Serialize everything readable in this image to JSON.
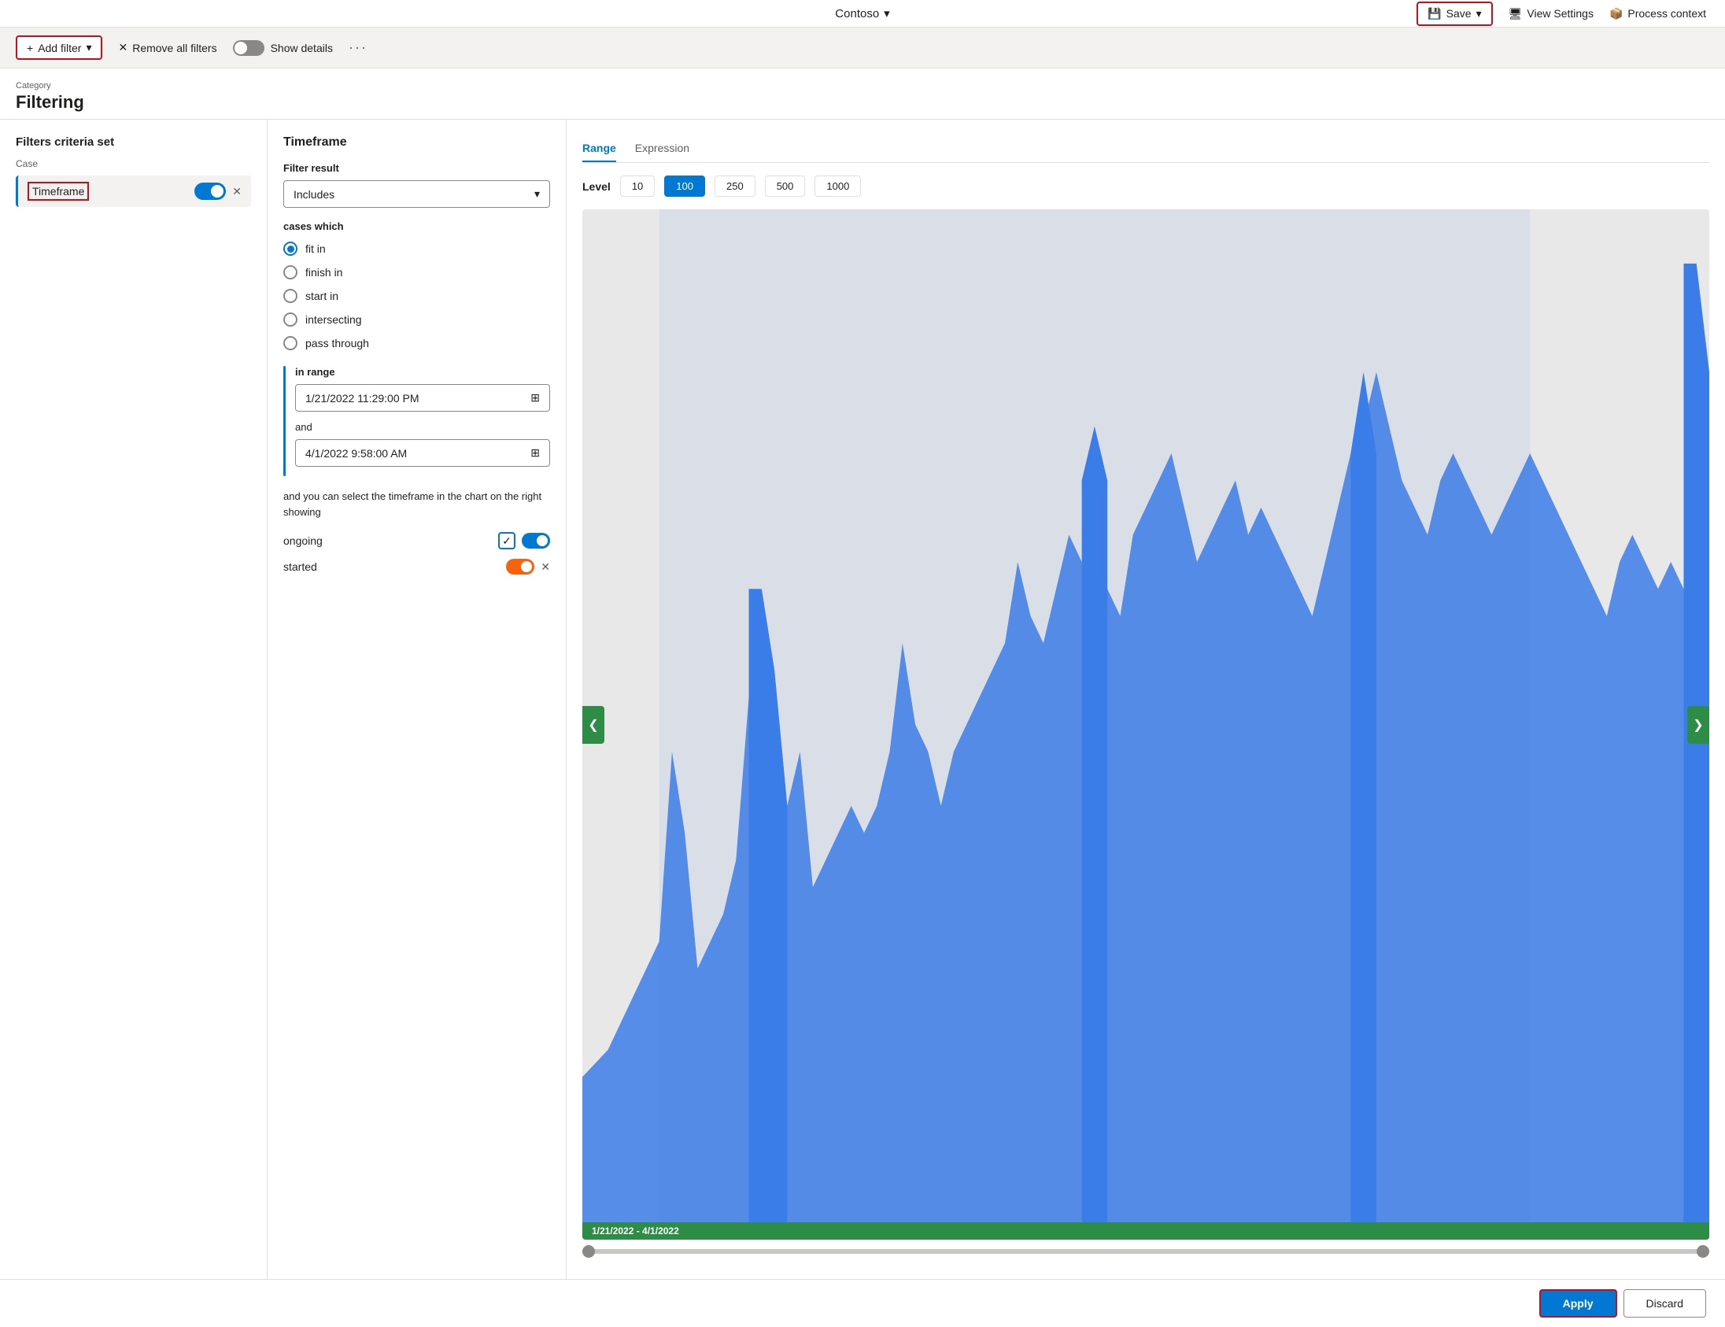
{
  "topnav": {
    "title": "Contoso",
    "save_label": "Save",
    "view_settings_label": "View Settings",
    "process_context_label": "Process context"
  },
  "toolbar": {
    "add_filter_label": "Add filter",
    "remove_all_label": "Remove all filters",
    "show_details_label": "Show details",
    "more_icon": "···"
  },
  "category": {
    "label": "Category",
    "title": "Filtering"
  },
  "left_panel": {
    "title": "Filters criteria set",
    "case_label": "Case",
    "filter_name": "Timeframe"
  },
  "mid_panel": {
    "title": "Timeframe",
    "filter_result_label": "Filter result",
    "filter_result_value": "Includes",
    "cases_which_label": "cases which",
    "radio_options": [
      {
        "id": "fit_in",
        "label": "fit in",
        "selected": true
      },
      {
        "id": "finish_in",
        "label": "finish in",
        "selected": false
      },
      {
        "id": "start_in",
        "label": "start in",
        "selected": false
      },
      {
        "id": "intersecting",
        "label": "intersecting",
        "selected": false
      },
      {
        "id": "pass_through",
        "label": "pass through",
        "selected": false
      }
    ],
    "in_range_label": "in range",
    "date_start": "1/21/2022 11:29:00 PM",
    "and_label": "and",
    "date_end": "4/1/2022 9:58:00 AM",
    "hint_text": "and you can select the timeframe in the chart on the right showing",
    "ongoing_label": "ongoing",
    "started_label": "started"
  },
  "right_panel": {
    "tabs": [
      {
        "id": "range",
        "label": "Range",
        "active": true
      },
      {
        "id": "expression",
        "label": "Expression",
        "active": false
      }
    ],
    "level_label": "Level",
    "level_options": [
      {
        "value": "10",
        "label": "10",
        "active": false
      },
      {
        "value": "100",
        "label": "100",
        "active": true
      },
      {
        "value": "250",
        "label": "250",
        "active": false
      },
      {
        "value": "500",
        "label": "500",
        "active": false
      },
      {
        "value": "1000",
        "label": "1000",
        "active": false
      }
    ],
    "chart_date_range": "1/21/2022 - 4/1/2022"
  },
  "bottom_bar": {
    "apply_label": "Apply",
    "discard_label": "Discard"
  },
  "icons": {
    "chevron_down": "▾",
    "plus": "+",
    "close": "✕",
    "calendar": "⊞",
    "check": "✓",
    "arrow_left": "❮",
    "arrow_right": "❯",
    "save": "💾",
    "monitor": "🖥",
    "box": "📦"
  }
}
